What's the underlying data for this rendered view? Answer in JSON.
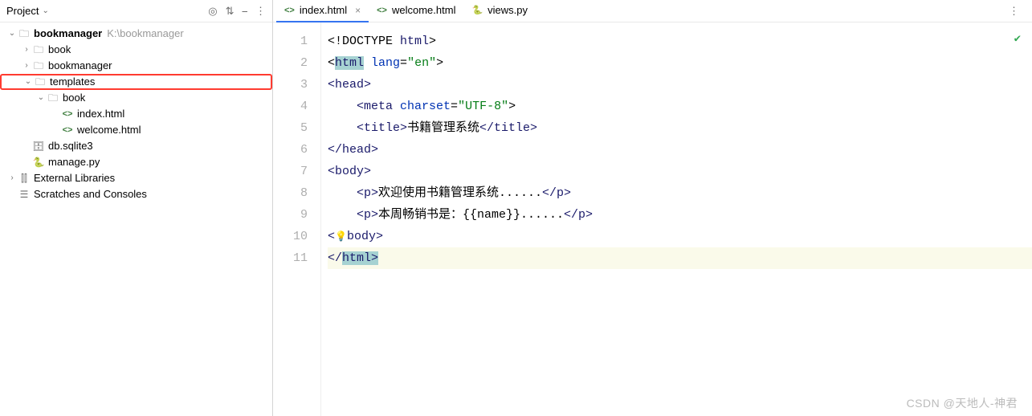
{
  "sidebar": {
    "title": "Project",
    "toolbar_icons": [
      "target",
      "collapse",
      "hide",
      "more"
    ],
    "tree": [
      {
        "depth": 0,
        "arrow": "v",
        "icon": "folder",
        "label": "bookmanager",
        "bold": true,
        "path": "K:\\bookmanager"
      },
      {
        "depth": 1,
        "arrow": ">",
        "icon": "folder",
        "label": "book"
      },
      {
        "depth": 1,
        "arrow": ">",
        "icon": "folder",
        "label": "bookmanager"
      },
      {
        "depth": 1,
        "arrow": "v",
        "icon": "folder",
        "label": "templates",
        "highlighted": true
      },
      {
        "depth": 2,
        "arrow": "v",
        "icon": "folder",
        "label": "book"
      },
      {
        "depth": 3,
        "arrow": "",
        "icon": "html",
        "label": "index.html"
      },
      {
        "depth": 3,
        "arrow": "",
        "icon": "html",
        "label": "welcome.html"
      },
      {
        "depth": 1,
        "arrow": "",
        "icon": "db",
        "label": "db.sqlite3"
      },
      {
        "depth": 1,
        "arrow": "",
        "icon": "python",
        "label": "manage.py"
      },
      {
        "depth": 0,
        "arrow": ">",
        "icon": "lib",
        "label": "External Libraries"
      },
      {
        "depth": 0,
        "arrow": "",
        "icon": "scratch",
        "label": "Scratches and Consoles"
      }
    ]
  },
  "tabs": [
    {
      "icon": "html",
      "label": "index.html",
      "active": true,
      "closeable": true
    },
    {
      "icon": "html",
      "label": "welcome.html",
      "active": false,
      "closeable": false
    },
    {
      "icon": "python",
      "label": "views.py",
      "active": false,
      "closeable": false
    }
  ],
  "code": {
    "current_line": 11,
    "lines_count": 11
  },
  "code_text": {
    "doctype1": "<!DOCTYPE ",
    "doctype2": "html",
    "doctype3": ">",
    "html_open1": "<",
    "html_open2": "html",
    "html_lang": " lang",
    "html_eq": "=",
    "html_val": "\"en\"",
    "html_gt": ">",
    "head_open": "<head>",
    "meta1": "    <",
    "meta2": "meta ",
    "meta3": "charset",
    "meta_eq": "=",
    "meta_val": "\"UTF-8\"",
    "meta_gt": ">",
    "title1": "    <title>",
    "title_text": "书籍管理系统",
    "title2": "</title>",
    "head_close": "</head>",
    "body_open": "<body>",
    "p1_1": "    <p>",
    "p1_text": "欢迎使用书籍管理系统......",
    "p1_2": "</p>",
    "p2_1": "    <p>",
    "p2_text": "本周畅销书是：{{name}}......",
    "p2_2": "</p>",
    "body_close1": "<",
    "body_close2": "/",
    "body_close3": "body>",
    "html_close1": "</",
    "html_close2": "html",
    "html_close3": ">"
  },
  "watermark": "CSDN @天地人-神君"
}
